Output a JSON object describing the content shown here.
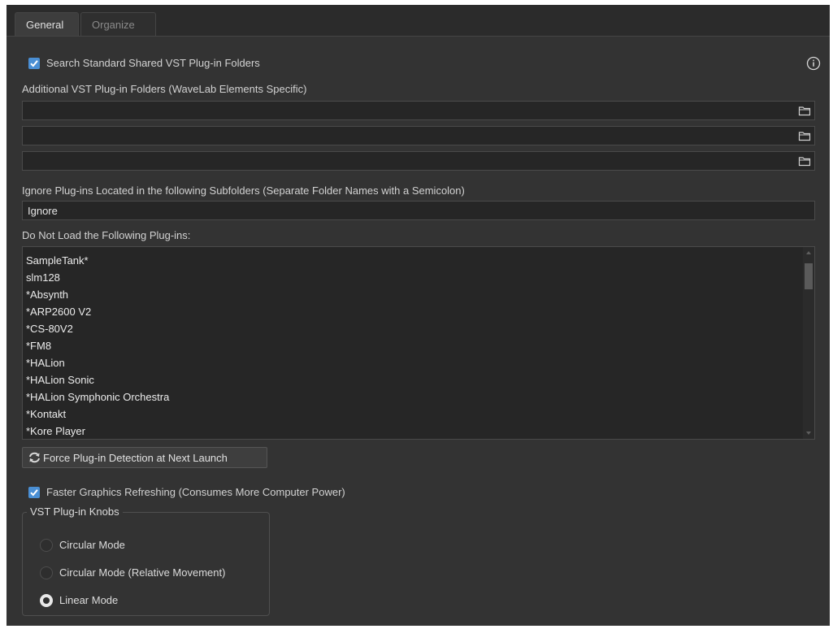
{
  "tabs": [
    {
      "label": "General",
      "active": true
    },
    {
      "label": "Organize",
      "active": false
    }
  ],
  "general": {
    "search_shared_label": "Search Standard Shared VST Plug-in Folders",
    "search_shared_checked": true,
    "additional_folders_label": "Additional VST Plug-in Folders (WaveLab Elements Specific)",
    "additional_folders": [
      "",
      "",
      ""
    ],
    "ignore_label": "Ignore Plug-ins Located in the following Subfolders (Separate Folder Names with a Semicolon)",
    "ignore_value": "Ignore",
    "do_not_load_label": "Do Not Load the Following Plug-ins:",
    "do_not_load_items": [
      "SampleTank*",
      "slm128",
      "*Absynth",
      "*ARP2600 V2",
      "*CS-80V2",
      "*FM8",
      "*HALion",
      "*HALion Sonic",
      "*HALion Symphonic Orchestra",
      "*Kontakt",
      "*Kore Player"
    ],
    "force_detection_label": "Force Plug-in Detection at Next Launch",
    "faster_graphics_label": "Faster Graphics Refreshing (Consumes More Computer Power)",
    "faster_graphics_checked": true,
    "knobs_group_title": "VST Plug-in Knobs",
    "knob_modes": [
      {
        "label": "Circular Mode",
        "selected": false
      },
      {
        "label": "Circular Mode (Relative Movement)",
        "selected": false
      },
      {
        "label": "Linear Mode",
        "selected": true
      }
    ]
  },
  "icons": {
    "info": "info-icon",
    "folder": "folder-icon",
    "refresh": "refresh-icon"
  },
  "colors": {
    "accent": "#4a8fd4",
    "panel_bg": "#333333",
    "field_bg": "#262626"
  }
}
